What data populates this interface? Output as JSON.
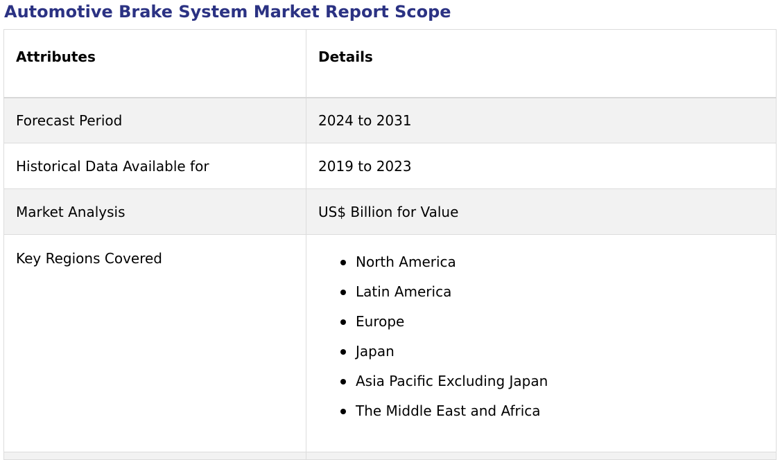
{
  "page_title": "Automotive Brake System Market Report Scope",
  "table": {
    "headers": [
      "Attributes",
      "Details"
    ],
    "rows": [
      {
        "attribute": "Forecast Period",
        "detail": "2024 to 2031"
      },
      {
        "attribute": "Historical Data Available for",
        "detail": "2019 to 2023"
      },
      {
        "attribute": "Market Analysis",
        "detail": "US$ Billion for Value"
      }
    ],
    "regions": {
      "attribute": "Key Regions Covered",
      "items": [
        "North America",
        "Latin America",
        "Europe",
        "Japan",
        "Asia Pacific Excluding Japan",
        "The Middle East and Africa"
      ]
    }
  },
  "colors": {
    "title": "#2b3283",
    "shaded_row": "#f2f2f2",
    "border": "#dcdcdc"
  }
}
